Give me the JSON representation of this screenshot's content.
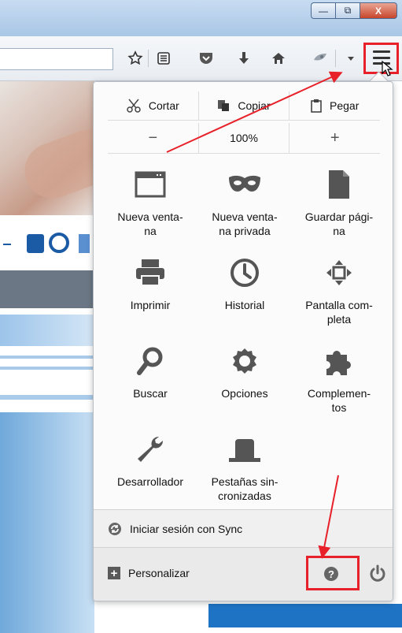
{
  "window": {
    "minimize_icon": "minimize-icon",
    "restore_icon": "restore-icon",
    "close_label": "X",
    "minimize_glyph": "—",
    "restore_glyph": "⧉"
  },
  "toolbar": {
    "icons": [
      "star-icon",
      "reading-list-icon",
      "pocket-icon",
      "download-icon",
      "home-icon",
      "extension-icon",
      "dropdown-icon",
      "hamburger-menu-icon"
    ]
  },
  "menu": {
    "edit": {
      "cut": "Cortar",
      "copy": "Copiar",
      "paste": "Pegar"
    },
    "zoom": {
      "minus": "−",
      "level": "100%",
      "plus": "+"
    },
    "items": [
      {
        "label": "Nueva venta-\nna",
        "icon": "new-window-icon"
      },
      {
        "label": "Nueva venta-\nna privada",
        "icon": "private-mask-icon"
      },
      {
        "label": "Guardar pági-\nna",
        "icon": "save-page-icon"
      },
      {
        "label": "Imprimir",
        "icon": "printer-icon"
      },
      {
        "label": "Historial",
        "icon": "history-clock-icon"
      },
      {
        "label": "Pantalla com-\npleta",
        "icon": "fullscreen-icon"
      },
      {
        "label": "Buscar",
        "icon": "search-icon"
      },
      {
        "label": "Opciones",
        "icon": "gear-icon"
      },
      {
        "label": "Complemen-\ntos",
        "icon": "puzzle-icon"
      },
      {
        "label": "Desarrollador",
        "icon": "wrench-icon"
      },
      {
        "label": "Pestañas sin-\ncronizadas",
        "icon": "synced-tabs-icon"
      }
    ],
    "sync": "Iniciar sesión con Sync",
    "customize": "Personalizar",
    "help_glyph": "?"
  },
  "colors": {
    "annotation": "#e8202a"
  }
}
